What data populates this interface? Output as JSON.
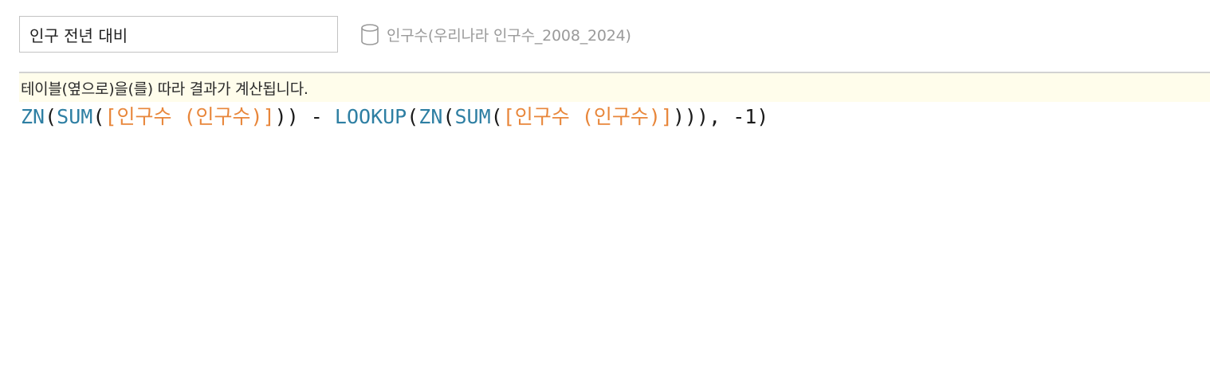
{
  "calc_name": "인구 전년 대비",
  "datasource": {
    "icon": "database-icon",
    "label": "인구수(우리나라 인구수_2008_2024)"
  },
  "hint": "테이블(옆으로)을(를) 따라 결과가 계산됩니다.",
  "formula": {
    "tokens": [
      {
        "type": "fn",
        "text": "ZN"
      },
      {
        "type": "punct",
        "text": "("
      },
      {
        "type": "fn",
        "text": "SUM"
      },
      {
        "type": "punct",
        "text": "("
      },
      {
        "type": "field",
        "text": "[인구수 (인구수)]"
      },
      {
        "type": "punct",
        "text": ")) - "
      },
      {
        "type": "fn",
        "text": "LOOKUP"
      },
      {
        "type": "punct",
        "text": "("
      },
      {
        "type": "fn",
        "text": "ZN"
      },
      {
        "type": "punct",
        "text": "("
      },
      {
        "type": "fn",
        "text": "SUM"
      },
      {
        "type": "punct",
        "text": "("
      },
      {
        "type": "field",
        "text": "[인구수 (인구수)]"
      },
      {
        "type": "punct",
        "text": "))), -1)"
      }
    ]
  },
  "colors": {
    "function": "#2e7fa3",
    "field": "#e8863a",
    "hint_background": "#fffdeb"
  }
}
